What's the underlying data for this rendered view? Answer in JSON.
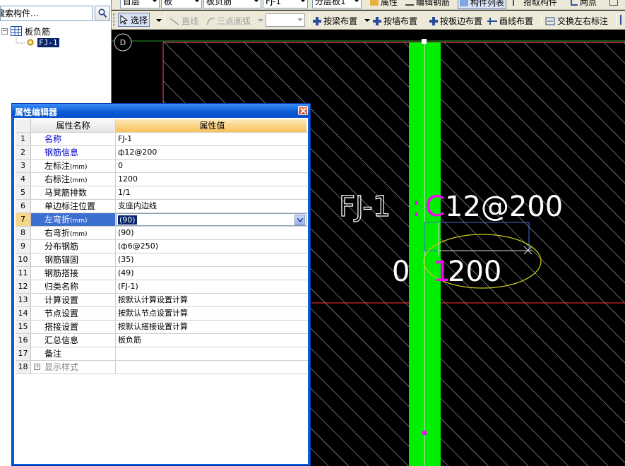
{
  "search": {
    "placeholder": "搜索构件..."
  },
  "tree": {
    "root": {
      "toggle": "−",
      "label": "板负筋"
    },
    "child": {
      "label": "FJ-1"
    }
  },
  "toolbar_top": {
    "floor": "首层",
    "category": "板",
    "subcategory": "板负筋",
    "element": "FJ-1",
    "layer": "分层板1",
    "buttons": [
      "属性",
      "编辑钢筋",
      "构件列表",
      "拾取构件",
      "两点"
    ]
  },
  "toolbar_second": {
    "select": "选择",
    "line": "直线",
    "arc": "三点画弧",
    "beam_place": "按梁布置",
    "wall_place": "按墙布置",
    "edge_place": "按板边布置",
    "line_place": "画线布置",
    "swap_labels": "交换左右标注"
  },
  "canvas": {
    "axis_label": "D",
    "rebar_prefix": "FJ-1",
    "rebar_colon": ":",
    "rebar_grade": "C",
    "rebar_spec": "12@200",
    "dim_left": "0",
    "dim_right_first": "1",
    "dim_right_rest": "200",
    "colors": {
      "wall": "#00ee00",
      "hatch": "#cfcfcf",
      "pink": "#ff4d6d",
      "magenta": "#ff00ff",
      "ellipse": "#c8c820",
      "dimline": "#3a6fd8"
    }
  },
  "prop_editor": {
    "title": "属性编辑器",
    "col_name": "属性名称",
    "col_value": "属性值",
    "rows": [
      {
        "num": "1",
        "name": "名称",
        "value": "FJ-1",
        "blue": true
      },
      {
        "num": "2",
        "name": "钢筋信息",
        "value": "ф12@200",
        "blue": true
      },
      {
        "num": "3",
        "name": "左标注",
        "unit": "(mm)",
        "value": "0"
      },
      {
        "num": "4",
        "name": "右标注",
        "unit": "(mm)",
        "value": "1200"
      },
      {
        "num": "5",
        "name": "马凳筋排数",
        "value": "1/1"
      },
      {
        "num": "6",
        "name": "单边标注位置",
        "value": "支座内边线"
      },
      {
        "num": "7",
        "name": "左弯折",
        "unit": "(mm)",
        "value": "(90)",
        "selected": true
      },
      {
        "num": "8",
        "name": "右弯折",
        "unit": "(mm)",
        "value": "(90)"
      },
      {
        "num": "9",
        "name": "分布钢筋",
        "value": "(ф6@250)"
      },
      {
        "num": "10",
        "name": "钢筋锚固",
        "value": "(35)"
      },
      {
        "num": "11",
        "name": "钢筋搭接",
        "value": "(49)"
      },
      {
        "num": "12",
        "name": "归类名称",
        "value": "(FJ-1)"
      },
      {
        "num": "13",
        "name": "计算设置",
        "value": "按默认计算设置计算"
      },
      {
        "num": "14",
        "name": "节点设置",
        "value": "按默认节点设置计算"
      },
      {
        "num": "15",
        "name": "搭接设置",
        "value": "按默认搭接设置计算"
      },
      {
        "num": "16",
        "name": "汇总信息",
        "value": "板负筋"
      },
      {
        "num": "17",
        "name": "备注",
        "value": ""
      },
      {
        "num": "18",
        "name": "显示样式",
        "value": "",
        "expander": "+"
      }
    ]
  }
}
